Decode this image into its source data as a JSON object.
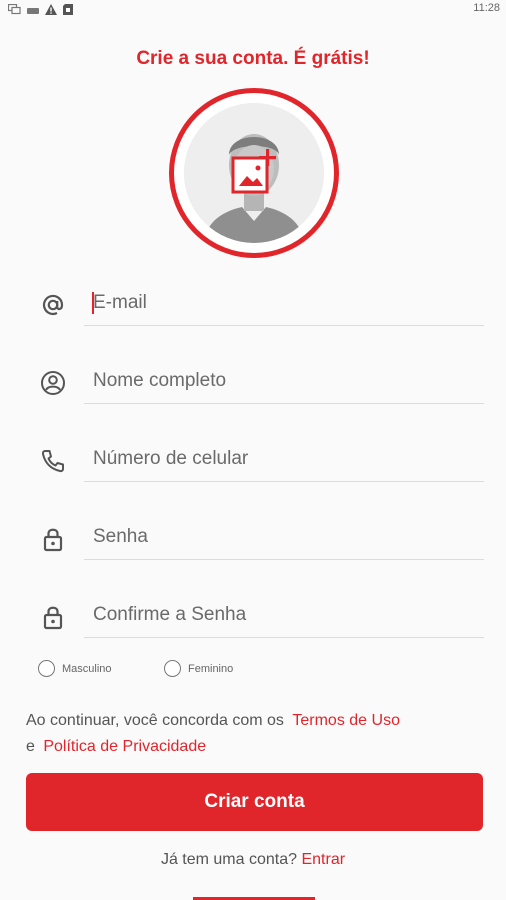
{
  "status_bar": {
    "time": "11:28",
    "icons": [
      "chat-icon",
      "keyboard-icon",
      "warning-icon",
      "sd-card-icon"
    ]
  },
  "header": {
    "title": "Crie a sua conta. É grátis!"
  },
  "avatar": {
    "icon": "add-photo-icon"
  },
  "form": {
    "email": {
      "placeholder": "E-mail",
      "icon": "at-icon"
    },
    "full_name": {
      "placeholder": "Nome completo",
      "icon": "user-circle-icon"
    },
    "phone": {
      "placeholder": "Número de celular",
      "icon": "phone-icon"
    },
    "password": {
      "placeholder": "Senha",
      "icon": "lock-icon"
    },
    "confirm_password": {
      "placeholder": "Confirme a Senha",
      "icon": "lock-icon"
    }
  },
  "gender": {
    "male_label": "Masculino",
    "female_label": "Feminino"
  },
  "terms": {
    "prefix": "Ao continuar, você concorda com os",
    "terms_link": "Termos de Uso",
    "connector": "e",
    "privacy_link": "Política de Privacidade"
  },
  "submit": {
    "label": "Criar conta"
  },
  "login": {
    "prompt": "Já tem uma conta?",
    "link": "Entrar"
  },
  "colors": {
    "accent": "#e0252b",
    "background": "#fafafa"
  }
}
